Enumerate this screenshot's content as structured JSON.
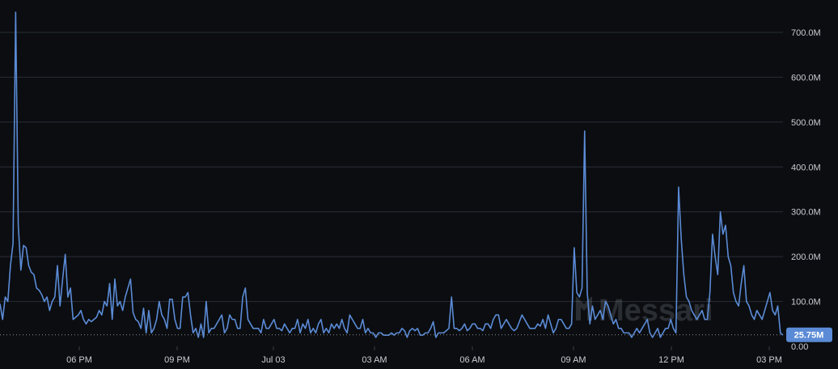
{
  "chart_data": {
    "type": "line",
    "title": "",
    "xlabel": "",
    "ylabel": "",
    "x_tick_labels": [
      "06 PM",
      "09 PM",
      "Jul 03",
      "03 AM",
      "06 AM",
      "09 AM",
      "12 PM",
      "03 PM"
    ],
    "y_tick_labels": [
      "0.00",
      "100.0M",
      "200.0M",
      "300.0M",
      "400.0M",
      "500.0M",
      "600.0M",
      "700.0M"
    ],
    "ylim": [
      0,
      760
    ],
    "y_unit": "M",
    "grid": true,
    "line_color": "#5b8bd6",
    "current_value_label": "25.75M",
    "current_value": 25.75,
    "watermark": "Messari",
    "series": [
      {
        "values": [
          95,
          60,
          110,
          100,
          180,
          230,
          745,
          270,
          170,
          225,
          220,
          180,
          165,
          160,
          130,
          125,
          115,
          100,
          110,
          80,
          100,
          110,
          180,
          90,
          150,
          205,
          110,
          130,
          60,
          65,
          70,
          80,
          60,
          50,
          60,
          55,
          60,
          65,
          80,
          70,
          100,
          90,
          140,
          60,
          150,
          90,
          100,
          80,
          110,
          130,
          150,
          75,
          60,
          55,
          40,
          85,
          30,
          80,
          30,
          40,
          60,
          100,
          70,
          60,
          40,
          105,
          105,
          60,
          40,
          40,
          110,
          110,
          120,
          70,
          30,
          40,
          20,
          50,
          20,
          100,
          30,
          40,
          40,
          50,
          60,
          70,
          30,
          40,
          70,
          60,
          60,
          40,
          40,
          110,
          130,
          60,
          50,
          40,
          40,
          40,
          30,
          60,
          40,
          40,
          50,
          60,
          40,
          40,
          35,
          50,
          40,
          30,
          40,
          40,
          60,
          30,
          50,
          40,
          60,
          30,
          40,
          30,
          50,
          60,
          30,
          40,
          30,
          50,
          40,
          50,
          40,
          60,
          40,
          30,
          70,
          60,
          50,
          40,
          40,
          60,
          30,
          40,
          30,
          30,
          20,
          30,
          30,
          25,
          25,
          25,
          30,
          25,
          30,
          30,
          40,
          35,
          20,
          35,
          40,
          35,
          40,
          25,
          25,
          30,
          30,
          40,
          55,
          20,
          30,
          30,
          30,
          35,
          40,
          110,
          40,
          40,
          35,
          40,
          50,
          35,
          40,
          50,
          50,
          40,
          40,
          35,
          50,
          50,
          40,
          60,
          70,
          70,
          40,
          50,
          60,
          50,
          40,
          35,
          40,
          55,
          70,
          60,
          50,
          40,
          40,
          40,
          50,
          45,
          60,
          40,
          70,
          50,
          30,
          40,
          60,
          60,
          50,
          40,
          40,
          50,
          220,
          120,
          110,
          130,
          480,
          120,
          50,
          90,
          60,
          70,
          80,
          60,
          100,
          90,
          70,
          50,
          60,
          40,
          40,
          30,
          30,
          30,
          20,
          30,
          40,
          30,
          40,
          50,
          60,
          30,
          20,
          30,
          40,
          20,
          30,
          40,
          40,
          60,
          40,
          30,
          355,
          240,
          160,
          110,
          100,
          80,
          70,
          60,
          70,
          80,
          60,
          60,
          120,
          250,
          200,
          160,
          300,
          250,
          270,
          200,
          180,
          120,
          100,
          90,
          140,
          180,
          100,
          90,
          70,
          60,
          80,
          70,
          60,
          80,
          100,
          120,
          80,
          70,
          90,
          30,
          25
        ]
      }
    ]
  }
}
